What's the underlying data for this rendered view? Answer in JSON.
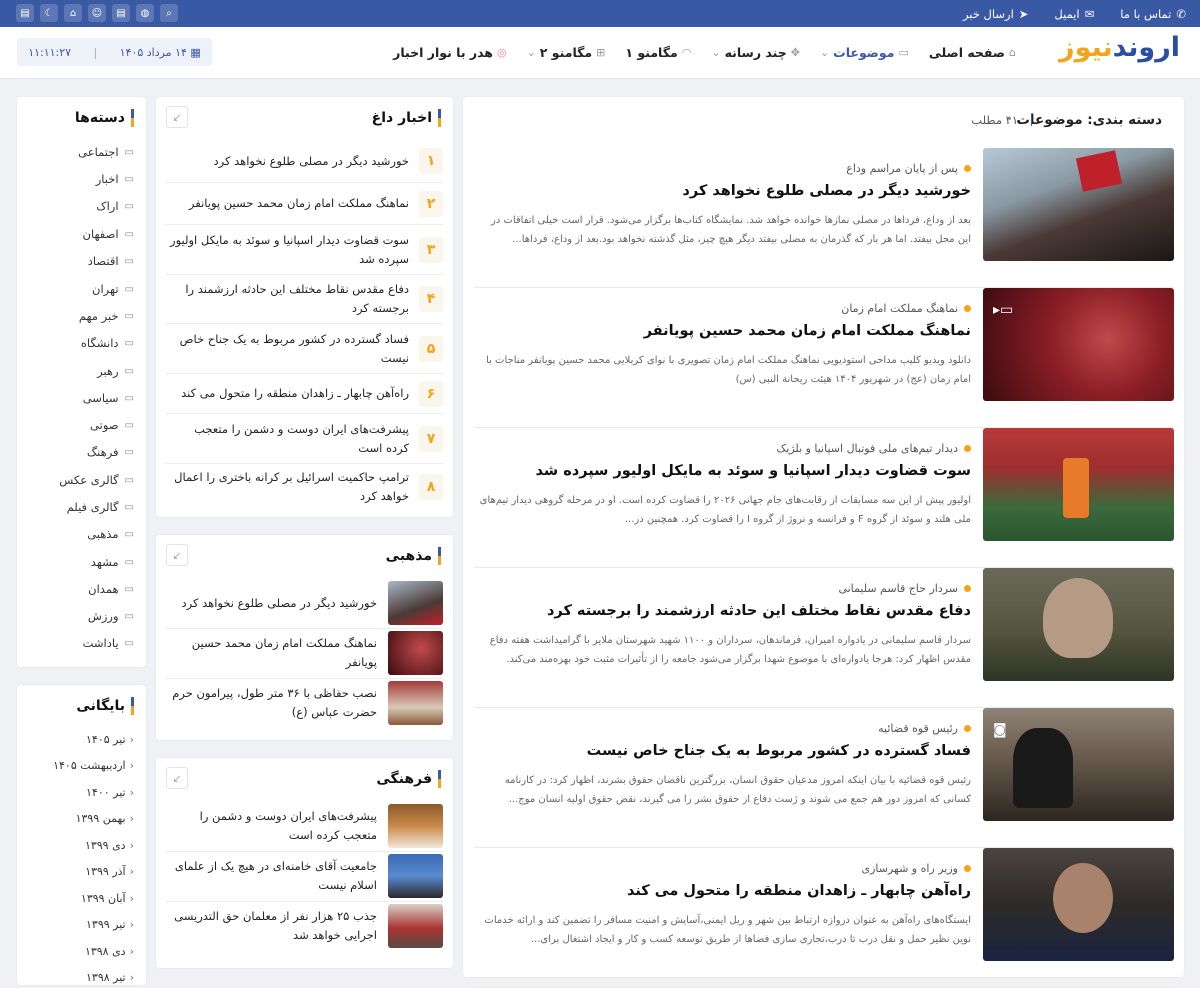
{
  "topbar": {
    "contact_label": "تماس با ما",
    "email_label": "ایمیل",
    "send_news_label": "ارسال خبر",
    "social_icons": [
      "search-icon",
      "globe-icon",
      "database-icon",
      "user-icon",
      "mosque-icon",
      "moon-icon",
      "database-icon-2"
    ]
  },
  "header": {
    "logo_part1": "اروند",
    "logo_part2": "نیوز",
    "nav": [
      {
        "label": "صفحه اصلی",
        "icon": "home-icon"
      },
      {
        "label": "موضوعات",
        "icon": "folder-icon",
        "active": true
      },
      {
        "label": "چند رسانه",
        "icon": "media-icon"
      },
      {
        "label": "مگامنو ۱",
        "icon": "rss-icon"
      },
      {
        "label": "مگامنو ۲",
        "icon": "sitemap-icon"
      },
      {
        "label": "هدر با نوار اخبار",
        "icon": "circle-icon"
      }
    ],
    "time": "۱۱:۱۱:۲۷",
    "date": "۱۴ مرداد ۱۴۰۵"
  },
  "main": {
    "heading": "دسته بندی: موضوعات",
    "count": "۴۱ مطلب",
    "articles": [
      {
        "kicker": "پس از پایان مراسم وداع",
        "title": "خورشید دیگر در مصلی طلوع نخواهد کرد",
        "excerpt": "بعد از وداع، فردا‌ها در مصلی نماز‌ها خوانده خواهد شد. نمایشگاه کتاب‌ها برگزار می‌شود. قرار است خیلی اتفاقات در این محل بیفتد. اما هر بار که گذرمان به مصلی بیفتد دیگر هیچ چیز، مثل گذشته نخواهد بود.بعد از وداع، فردا‌ها...",
        "media": ""
      },
      {
        "kicker": "نماهنگ مملکت امام زمان",
        "title": "نماهنگ مملکت امام زمان محمد حسین پویانفر",
        "excerpt": "دانلود ویدیو کلیپ مداحی استودیویی نماهنگ مملکت امام زمان تصویری با نوای کربلایی محمد حسین پویانفر مناجات با امام زمان (عج) در شهریور ۱۴۰۴ هیئت ریحانة النبی (س)",
        "media": "video"
      },
      {
        "kicker": "دیدار تیم‌های ملی فوتبال اسپانیا و بلژیک",
        "title": "سوت قضاوت دیدار اسپانیا و سوئد به مایکل اولیور سپرده شد",
        "excerpt": "اولیور پیش از این سه مسابقات از رقابت‌های جام جهانی ۲۰۲۶ را قضاوت کرده است. او در مرحله گروهی دیدار تیم‌های ملی هلند و سوئد از گروه F و فرانسه و نروژ از گروه I را قضاوت کرد. همچنین در...",
        "media": ""
      },
      {
        "kicker": "سردار حاج قاسم سلیمانی",
        "title": "دفاع مقدس نقاط مختلف این حادثه ارزشمند را برجسته کرد",
        "excerpt": "سردار قاسم سلیمانی در یادواره امیران، فرماندهان، سرداران و ۱۱۰۰ شهید شهرستان ملایر با گرامیداشت هفته دفاع مقدس اظهار کرد: هرجا یادواره‌ای با موضوع شهدا برگزار می‌شود جامعه را از تأثیرات مثبت خود بهره‌مند می‌کند.",
        "media": ""
      },
      {
        "kicker": "رئیس قوه قضائیه",
        "title": "فساد گسترده در کشور مربوط به یک جناح خاص نیست",
        "excerpt": "رئیس قوه قضائیه با بیان اینکه امروز مدعیان حقوق انسان، بزرگترین ناقضان حقوق بشرند، اظهار کرد: در کارنامه کسانی که امروز دور هم جمع می شوند و ژست دفاع از حقوق بشر را می گیرند، نقض حقوق اولیه انسان موج...",
        "media": "photo"
      },
      {
        "kicker": "وزیر راه و شهرسازی",
        "title": "راه‌آهن چابهار ـ زاهدان منطقه را متحول می کند",
        "excerpt": "ایستگاه‌های راه‌آهن به عنوان دروازه ارتباط بین شهر و ریل ایمنی،آسایش و امنیت مسافر را تضمین کند و ارائه خدمات نوین نظیر حمل و نقل درب تا درب،تجاری سازی فضاها از طریق توسعه کسب و کار و ایجاد اشتغال برای...",
        "media": ""
      }
    ]
  },
  "hot": {
    "title": "اخبار داغ",
    "items": [
      {
        "num": "۱",
        "title": "خورشید دیگر در مصلی طلوع نخواهد کرد"
      },
      {
        "num": "۲",
        "title": "نماهنگ مملکت امام زمان محمد حسین پویانفر"
      },
      {
        "num": "۳",
        "title": "سوت قضاوت دیدار اسپانیا و سوئد به مایکل اولیور سپرده شد"
      },
      {
        "num": "۴",
        "title": "دفاع مقدس نقاط مختلف این حادثه ارزشمند را برجسته کرد"
      },
      {
        "num": "۵",
        "title": "فساد گسترده در کشور مربوط به یک جناح خاص نیست"
      },
      {
        "num": "۶",
        "title": "راه‌آهن چابهار ـ زاهدان منطقه را متحول می کند"
      },
      {
        "num": "۷",
        "title": "پیشرفت‌های ایران دوست و دشمن را متعجب کرده است"
      },
      {
        "num": "۸",
        "title": "ترامپ حاکمیت اسرائیل بر کرانه باختری را اعمال خواهد کرد"
      }
    ]
  },
  "religious": {
    "title": "مذهبی",
    "items": [
      {
        "title": "خورشید دیگر در مصلی طلوع نخواهد کرد"
      },
      {
        "title": "نماهنگ مملکت امام زمان محمد حسین پویانفر"
      },
      {
        "title": "نصب حفاظی با ۳۶ متر طول، پیرامون حرم حضرت عباس (ع)"
      }
    ]
  },
  "cultural": {
    "title": "فرهنگی",
    "items": [
      {
        "title": "پیشرفت‌های ایران دوست و دشمن را متعجب کرده است"
      },
      {
        "title": "جامعیت آقای خامنه‌ای در هیچ یک از علمای اسلام نیست"
      },
      {
        "title": "جذب ۲۵ هزار نفر از معلمان حق التدریسی اجرایی خواهد شد"
      }
    ]
  },
  "categories": {
    "title": "دسته‌ها",
    "items": [
      "اجتماعی",
      "اخبار",
      "اراک",
      "اصفهان",
      "اقتصاد",
      "تهران",
      "خبر مهم",
      "دانشگاه",
      "رهبر",
      "سیاسی",
      "صوتی",
      "فرهنگ",
      "گالری عکس",
      "گالری فیلم",
      "مذهبی",
      "مشهد",
      "همدان",
      "ورزش",
      "یاداشت"
    ]
  },
  "archive": {
    "title": "بایگانی",
    "items": [
      "تیر ۱۴۰۵",
      "اردیبهشت ۱۴۰۵",
      "تیر ۱۴۰۰",
      "بهمن ۱۳۹۹",
      "دی ۱۳۹۹",
      "آذر ۱۳۹۹",
      "آبان ۱۳۹۹",
      "تیر ۱۳۹۹",
      "دی ۱۳۹۸",
      "تیر ۱۳۹۸"
    ]
  }
}
